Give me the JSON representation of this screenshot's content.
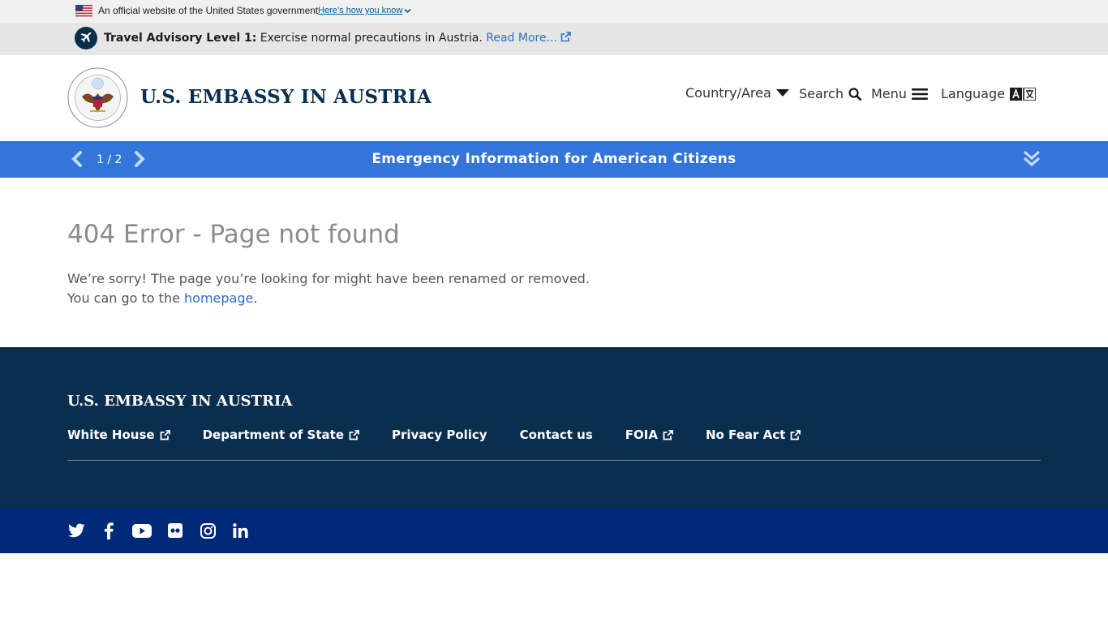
{
  "gov_banner": {
    "text": "An official website of the United States government",
    "link": "Here’s how you know"
  },
  "advisory": {
    "level": "Travel Advisory Level 1:",
    "message": " Exercise normal precautions in Austria. ",
    "link": "Read More..."
  },
  "header": {
    "title": "U.S. EMBASSY IN AUSTRIA",
    "nav": {
      "country": "Country/Area",
      "search": "Search",
      "menu": "Menu",
      "language": "Language"
    }
  },
  "emergency": {
    "counter": "1 / 2",
    "title": "Emergency Information for American Citizens"
  },
  "main": {
    "title": "404 Error - Page not found",
    "line1": "We’re sorry! The page you’re looking for might have been renamed or removed.",
    "line2_prefix": "You can go to the ",
    "line2_link": "homepage",
    "line2_suffix": "."
  },
  "footer": {
    "title": "U.S. EMBASSY IN AUSTRIA",
    "links": [
      "White House",
      "Department of State",
      "Privacy Policy",
      "Contact us",
      "FOIA",
      "No Fear Act"
    ]
  },
  "social": [
    "twitter-icon",
    "facebook-icon",
    "youtube-icon",
    "flickr-icon",
    "instagram-icon",
    "linkedin-icon"
  ],
  "colors": {
    "navy": "#0a2e4d",
    "blue_bar": "#3375d9",
    "social_bar": "#00297a",
    "link": "#2f6ec2"
  }
}
